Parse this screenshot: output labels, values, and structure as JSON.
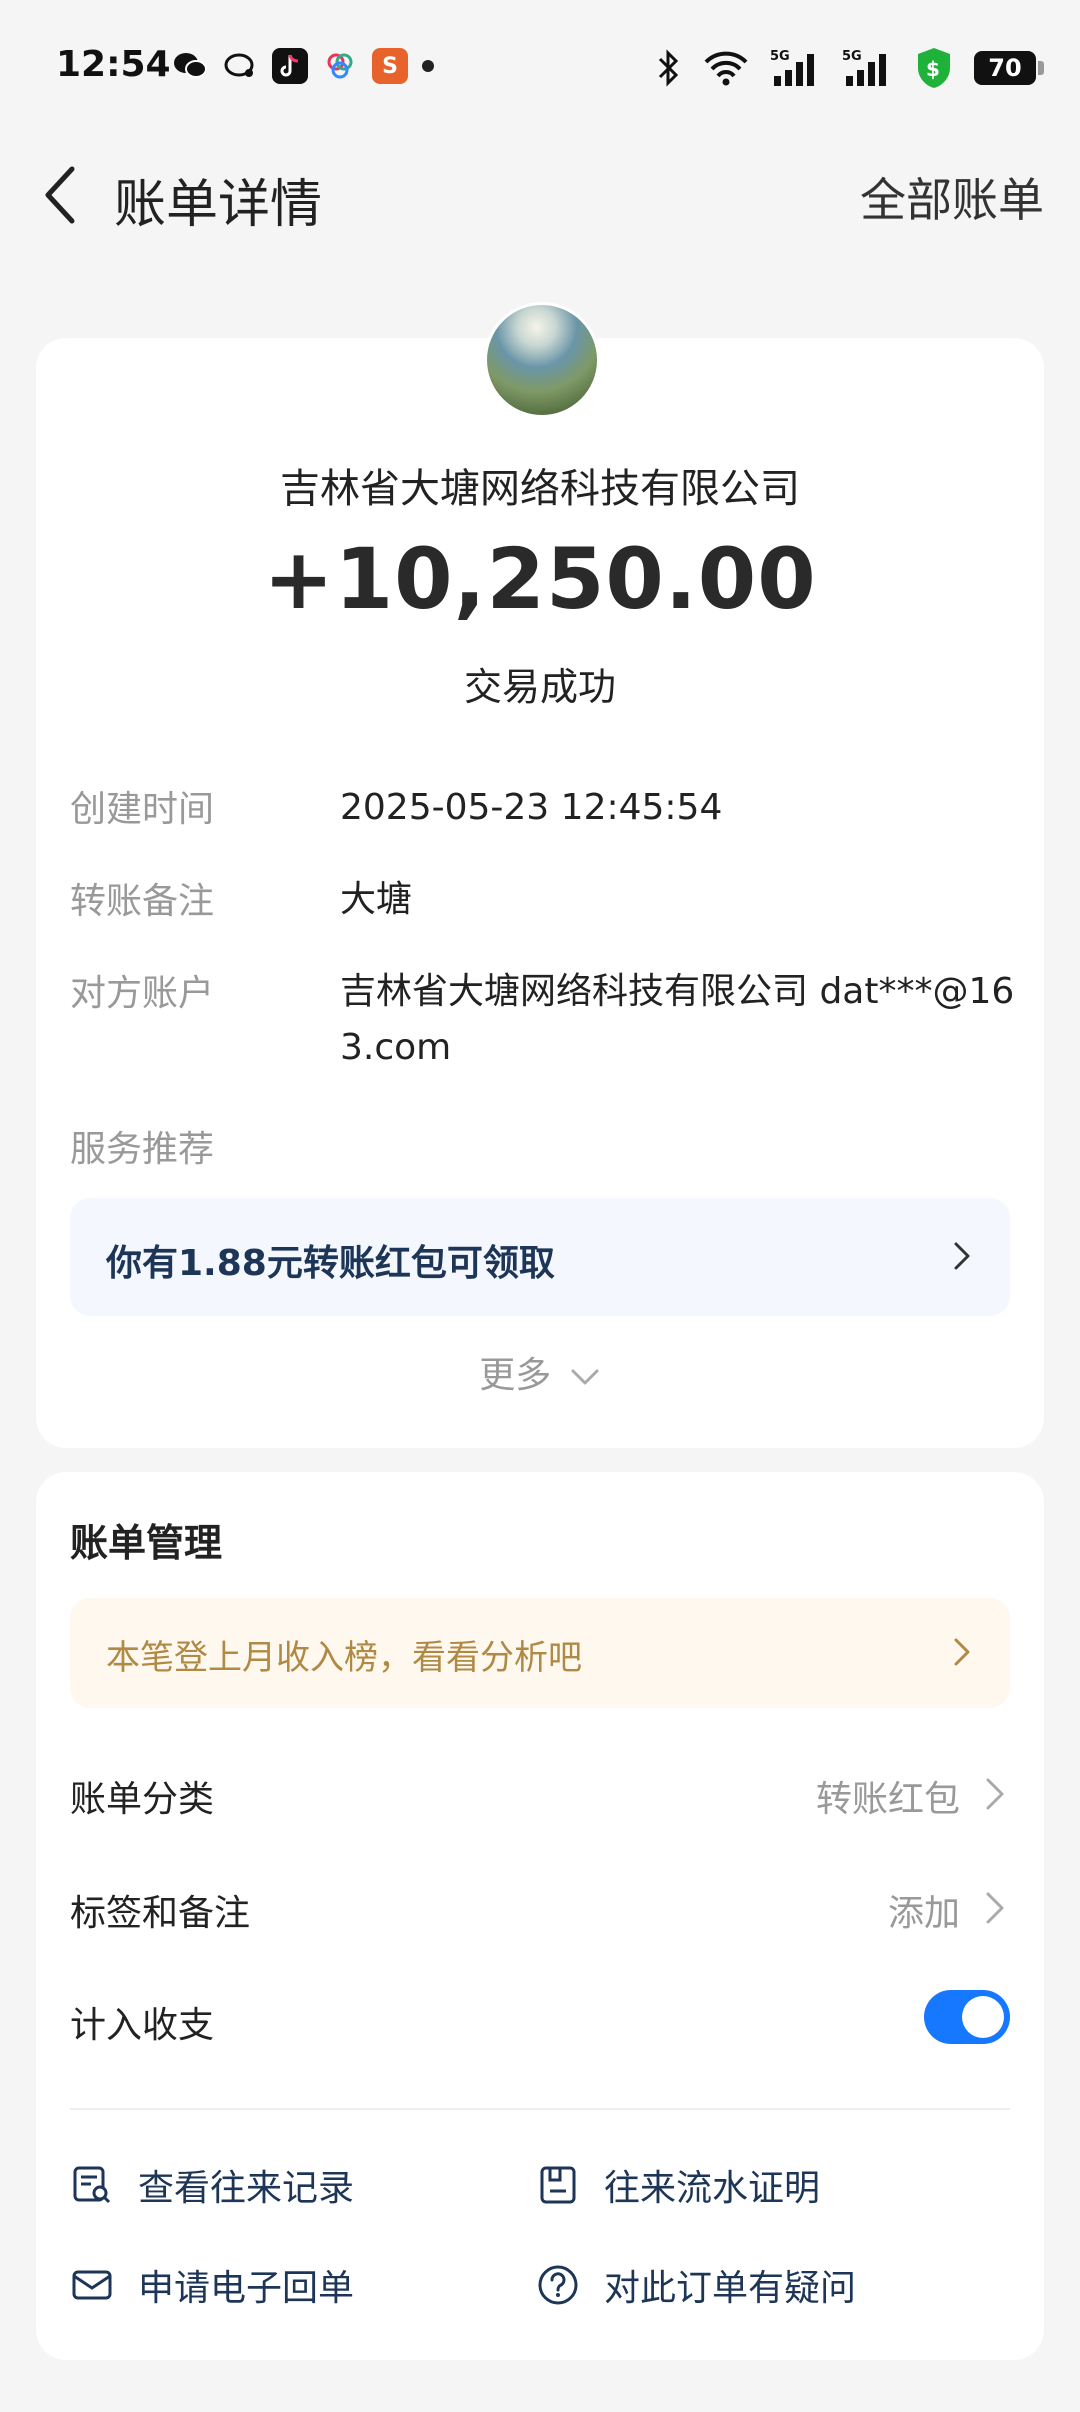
{
  "status_bar": {
    "time": "12:54",
    "battery": "70",
    "network_1": "5G",
    "network_2": "5G"
  },
  "header": {
    "title": "账单详情",
    "right_link": "全部账单"
  },
  "transaction": {
    "counterparty": "吉林省大塘网络科技有限公司",
    "amount": "+10,250.00",
    "status": "交易成功",
    "details": [
      {
        "label": "创建时间",
        "value": "2025-05-23 12:45:54"
      },
      {
        "label": "转账备注",
        "value": "大塘"
      },
      {
        "label": "对方账户",
        "value": "吉林省大塘网络科技有限公司 dat***@163.com"
      }
    ],
    "service_label": "服务推荐",
    "promo": "你有1.88元转账红包可领取",
    "more": "更多"
  },
  "management": {
    "title": "账单管理",
    "notice": "本笔登上月收入榜，看看分析吧",
    "category_label": "账单分类",
    "category_value": "转账红包",
    "tags_label": "标签和备注",
    "tags_value": "添加",
    "count_label": "计入收支",
    "count_enabled": true,
    "links": [
      "查看往来记录",
      "往来流水证明",
      "申请电子回单",
      "对此订单有疑问"
    ]
  },
  "colors": {
    "accent": "#1677ff",
    "notice_text": "#b08a45",
    "link_text": "#1d3557"
  }
}
